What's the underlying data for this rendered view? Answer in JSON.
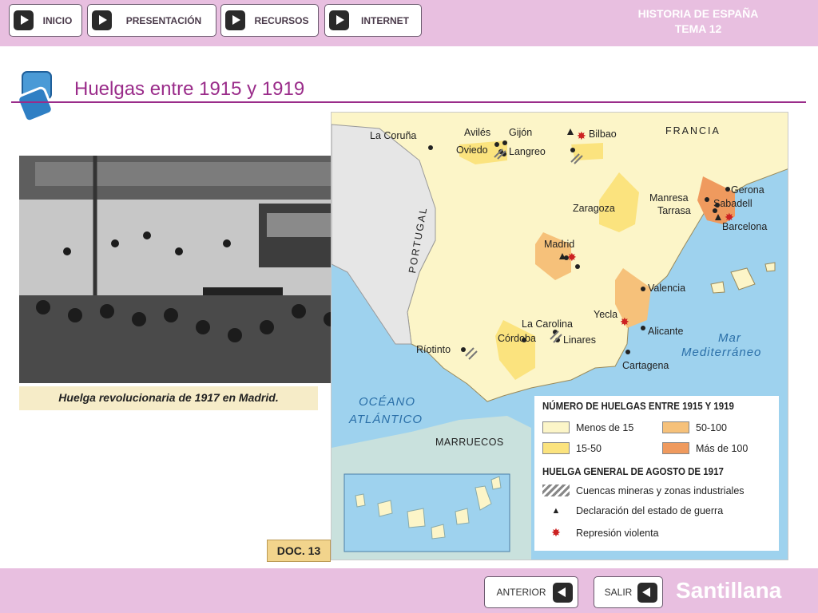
{
  "nav": {
    "inicio": "INICIO",
    "presentacion": "PRESENTACIÓN",
    "recursos": "RECURSOS",
    "internet": "INTERNET"
  },
  "header": {
    "line1": "HISTORIA DE ESPAÑA",
    "line2": "TEMA 12"
  },
  "page_title": "Huelgas entre 1915 y 1919",
  "photo_caption": "Huelga revolucionaria de 1917 en Madrid.",
  "map": {
    "places": {
      "la_coruna": "La Coruña",
      "aviles": "Avilés",
      "gijon": "Gijón",
      "oviedo": "Oviedo",
      "langreo": "Langreo",
      "bilbao": "Bilbao",
      "francia": "FRANCIA",
      "gerona": "Gerona",
      "manresa": "Manresa",
      "tarrasa": "Tarrasa",
      "sabadell": "Sabadell",
      "barcelona": "Barcelona",
      "zaragoza": "Zaragoza",
      "madrid": "Madrid",
      "portugal": "PORTUGAL",
      "valencia": "Valencia",
      "yecla": "Yecla",
      "la_carolina": "La Carolina",
      "alicante": "Alicante",
      "cordoba": "Córdoba",
      "linares": "Linares",
      "riotinto": "Ríotinto",
      "cartagena": "Cartagena",
      "mar": "Mar",
      "mediterraneo": "Mediterráneo",
      "oceano": "OCÉANO",
      "atlantico": "ATLÁNTICO",
      "marruecos": "MARRUECOS"
    },
    "legend": {
      "title1": "NÚMERO DE HUELGAS ENTRE 1915 Y 1919",
      "menos15": "Menos de 15",
      "r50_100": "50-100",
      "r15_50": "15-50",
      "mas100": "Más de 100",
      "title2": "HUELGA GENERAL DE AGOSTO DE 1917",
      "cuencas": "Cuencas mineras y zonas industriales",
      "declaracion": "Declaración del estado de guerra",
      "represion": "Represión violenta"
    },
    "colors": {
      "menos15": "#fcf5c8",
      "r15_50": "#fbe37e",
      "r50_100": "#f6c17a",
      "mas100": "#ef9a5e",
      "sea": "#9ed2ee"
    }
  },
  "doc_label": "DOC. 13",
  "footer": {
    "anterior": "ANTERIOR",
    "salir": "SALIR",
    "brand": "Santillana"
  }
}
